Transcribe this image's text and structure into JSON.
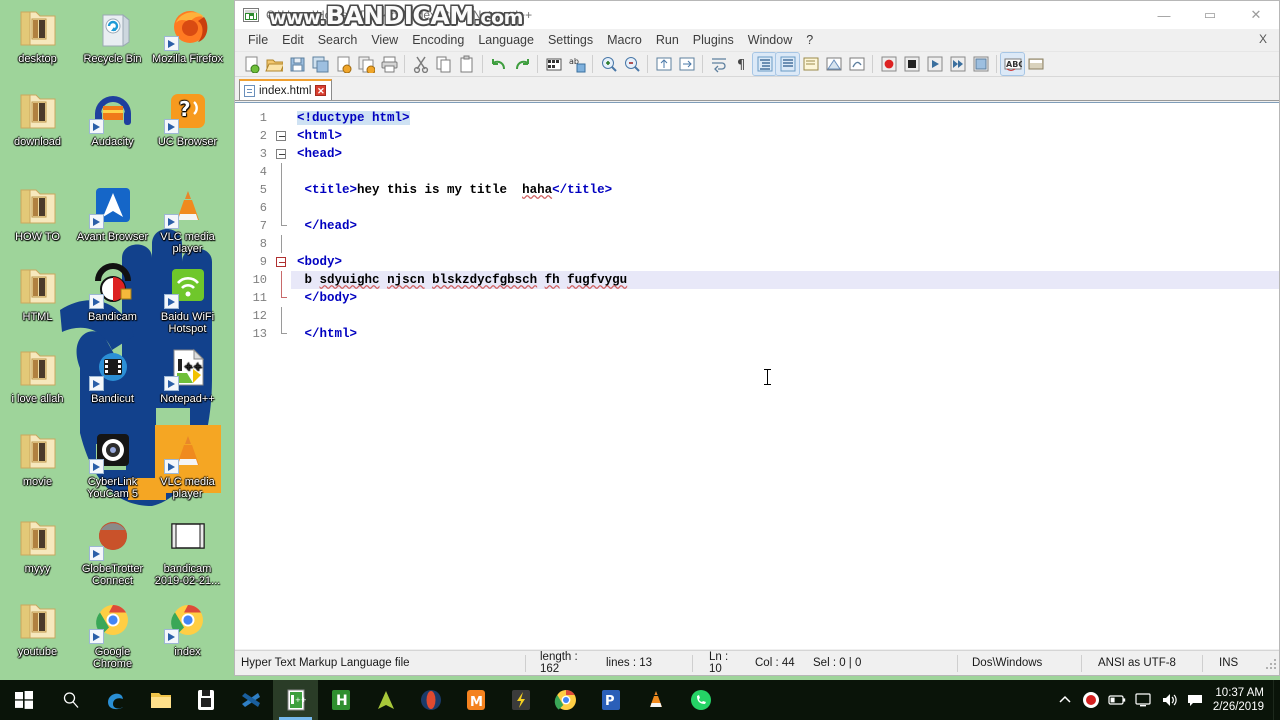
{
  "desktop": {
    "background_color": "#9ed49a",
    "icons": [
      {
        "label": "desktop",
        "icon": "folder-icon",
        "col": 0,
        "row": 0
      },
      {
        "label": "Recycle Bin",
        "icon": "recycle-bin-icon",
        "col": 1,
        "row": 0
      },
      {
        "label": "Mozilla Firefox",
        "icon": "firefox-icon",
        "col": 2,
        "row": 0
      },
      {
        "label": "download",
        "icon": "folder-icon",
        "col": 0,
        "row": 1
      },
      {
        "label": "Audacity",
        "icon": "audacity-icon",
        "col": 1,
        "row": 1
      },
      {
        "label": "UC Browser",
        "icon": "uc-browser-icon",
        "col": 2,
        "row": 1
      },
      {
        "label": "HOW TO",
        "icon": "folder-icon",
        "col": 0,
        "row": 2
      },
      {
        "label": "Avant Browser",
        "icon": "avant-browser-icon",
        "col": 1,
        "row": 2
      },
      {
        "label": "VLC media player",
        "icon": "vlc-icon",
        "col": 2,
        "row": 2
      },
      {
        "label": "HTML",
        "icon": "folder-icon",
        "col": 0,
        "row": 3
      },
      {
        "label": "Bandicam",
        "icon": "bandicam-icon",
        "col": 1,
        "row": 3
      },
      {
        "label": "Baidu WiFi Hotspot",
        "icon": "baidu-wifi-icon",
        "col": 2,
        "row": 3
      },
      {
        "label": "i love allah",
        "icon": "folder-icon",
        "col": 0,
        "row": 4
      },
      {
        "label": "Bandicut",
        "icon": "bandicut-icon",
        "col": 1,
        "row": 4
      },
      {
        "label": "Notepad++",
        "icon": "notepadpp-icon",
        "col": 2,
        "row": 4
      },
      {
        "label": "movie",
        "icon": "folder-icon",
        "col": 0,
        "row": 5
      },
      {
        "label": "CyberLink YouCam 5",
        "icon": "youcam-icon",
        "col": 1,
        "row": 5
      },
      {
        "label": "VLC media player",
        "icon": "vlc-icon",
        "col": 2,
        "row": 5
      },
      {
        "label": "myyy",
        "icon": "folder-icon",
        "col": 0,
        "row": 6
      },
      {
        "label": "GlobeTrotter Connect",
        "icon": "globetrotter-icon",
        "col": 1,
        "row": 6
      },
      {
        "label": "bandicam 2019-02-21...",
        "icon": "video-file-icon",
        "col": 2,
        "row": 6
      },
      {
        "label": "youtube",
        "icon": "folder-icon",
        "col": 0,
        "row": 7
      },
      {
        "label": "Google Chrome",
        "icon": "chrome-icon",
        "col": 1,
        "row": 7
      },
      {
        "label": "index",
        "icon": "chrome-icon",
        "col": 2,
        "row": 7
      }
    ]
  },
  "watermark": {
    "prefix": "www.",
    "main": "BANDICAM",
    "suffix": ".com"
  },
  "notepadpp": {
    "title": "C:\\Users\\HoZleR\\Desktop\\index.html - Notepad++",
    "window_buttons": {
      "minimize": "—",
      "maximize": "▭",
      "close": "✕"
    },
    "menu": [
      "File",
      "Edit",
      "Search",
      "View",
      "Encoding",
      "Language",
      "Settings",
      "Macro",
      "Run",
      "Plugins",
      "Window",
      "?"
    ],
    "menu_close_label": "X",
    "toolbar": [
      {
        "name": "new-file-button"
      },
      {
        "name": "open-file-button"
      },
      {
        "name": "save-button"
      },
      {
        "name": "save-all-button"
      },
      {
        "name": "close-button"
      },
      {
        "name": "close-all-button"
      },
      {
        "name": "print-button"
      },
      {
        "sep": true
      },
      {
        "name": "cut-button"
      },
      {
        "name": "copy-button"
      },
      {
        "name": "paste-button"
      },
      {
        "sep": true
      },
      {
        "name": "undo-button"
      },
      {
        "name": "redo-button"
      },
      {
        "sep": true
      },
      {
        "name": "find-button"
      },
      {
        "name": "replace-button"
      },
      {
        "sep": true
      },
      {
        "name": "zoom-in-button"
      },
      {
        "name": "zoom-out-button"
      },
      {
        "sep": true
      },
      {
        "name": "sync-vertical-scroll-button"
      },
      {
        "name": "sync-horizontal-scroll-button"
      },
      {
        "sep": true
      },
      {
        "name": "word-wrap-button"
      },
      {
        "name": "show-all-chars-button"
      },
      {
        "name": "indent-guide-button"
      },
      {
        "name": "show-indent-guide-button"
      },
      {
        "name": "user-defined-dialog-button"
      },
      {
        "name": "document-map-button"
      },
      {
        "name": "function-list-button"
      },
      {
        "sep": true
      },
      {
        "name": "start-record-macro-button"
      },
      {
        "name": "stop-record-macro-button"
      },
      {
        "name": "playback-macro-button"
      },
      {
        "name": "run-macro-multiple-button"
      },
      {
        "name": "save-macro-button"
      },
      {
        "sep": true
      },
      {
        "name": "spell-check-button"
      },
      {
        "name": "run-button"
      }
    ],
    "tab": {
      "label": "index.html",
      "close": "✕"
    },
    "editor": {
      "line_numbers": [
        1,
        2,
        3,
        4,
        5,
        6,
        7,
        8,
        9,
        10,
        11,
        12,
        13
      ],
      "current_line": 10,
      "lines": [
        {
          "n": 1,
          "text": "<!ductype html>"
        },
        {
          "n": 2,
          "text": "<html>"
        },
        {
          "n": 3,
          "text": "<head>"
        },
        {
          "n": 4,
          "text": ""
        },
        {
          "n": 5,
          "text": " <title>hey this is my title  haha</title>"
        },
        {
          "n": 6,
          "text": ""
        },
        {
          "n": 7,
          "text": " </head>"
        },
        {
          "n": 8,
          "text": ""
        },
        {
          "n": 9,
          "text": "<body>"
        },
        {
          "n": 10,
          "text": " b sdyuighc njscn blskzdycfgbsch fh fugfvygu"
        },
        {
          "n": 11,
          "text": " </body>"
        },
        {
          "n": 12,
          "text": ""
        },
        {
          "n": 13,
          "text": " </html>"
        }
      ]
    },
    "statusbar": {
      "doc_type": "Hyper Text Markup Language file",
      "length_label": "length : 162",
      "lines_label": "lines : 13",
      "ln": "Ln : 10",
      "col": "Col : 44",
      "sel": "Sel : 0 | 0",
      "eol": "Dos\\Windows",
      "encoding": "ANSI as UTF-8",
      "insert_mode": "INS"
    }
  },
  "taskbar": {
    "start": "start-button",
    "search": "search-icon",
    "items": [
      {
        "name": "taskbar-edge",
        "icon": "edge-icon"
      },
      {
        "name": "taskbar-file-explorer",
        "icon": "file-explorer-icon"
      },
      {
        "name": "taskbar-microsoft-store",
        "icon": "store-icon"
      },
      {
        "name": "taskbar-bandicut",
        "icon": "bandicut-icon"
      },
      {
        "name": "taskbar-notepadpp",
        "icon": "notepadpp-icon",
        "running": true
      },
      {
        "name": "taskbar-hotspot",
        "icon": "hotspot-icon"
      },
      {
        "name": "taskbar-avant-browser",
        "icon": "avant-browser-icon"
      },
      {
        "name": "taskbar-opera",
        "icon": "opera-icon"
      },
      {
        "name": "taskbar-uc-browser",
        "icon": "uc-browser-icon"
      },
      {
        "name": "taskbar-idm",
        "icon": "idm-icon"
      },
      {
        "name": "taskbar-chrome",
        "icon": "chrome-icon"
      },
      {
        "name": "taskbar-powerpoint",
        "icon": "powerpoint-icon"
      },
      {
        "name": "taskbar-vlc",
        "icon": "vlc-icon"
      },
      {
        "name": "taskbar-whatsapp",
        "icon": "whatsapp-icon"
      }
    ],
    "tray": [
      {
        "name": "show-hidden-icons",
        "icon": "chevron-up-icon"
      },
      {
        "name": "bandicam-recording",
        "icon": "record-icon"
      },
      {
        "name": "battery",
        "icon": "battery-icon"
      },
      {
        "name": "network",
        "icon": "monitor-icon"
      },
      {
        "name": "volume",
        "icon": "speaker-icon"
      },
      {
        "name": "action-center",
        "icon": "notification-icon"
      }
    ],
    "clock": {
      "time": "10:37 AM",
      "date": "2/26/2019"
    }
  }
}
